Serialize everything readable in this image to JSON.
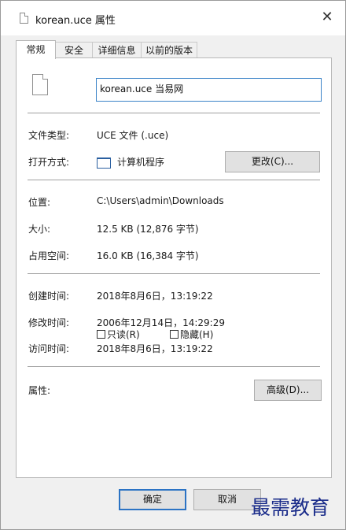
{
  "window": {
    "title": "korean.uce 属性",
    "close_glyph": "✕"
  },
  "tabs": [
    {
      "label": "常规"
    },
    {
      "label": "安全"
    },
    {
      "label": "详细信息"
    },
    {
      "label": "以前的版本"
    }
  ],
  "general": {
    "file_name": "korean.uce   当易网",
    "file_type_label": "文件类型:",
    "file_type_value": "UCE 文件 (.uce)",
    "open_with_label": "打开方式:",
    "open_with_value": "计算机程序",
    "change_button": "更改(C)...",
    "location_label": "位置:",
    "location_value": "C:\\Users\\admin\\Downloads",
    "size_label": "大小:",
    "size_value": "12.5 KB (12,876 字节)",
    "size_on_disk_label": "占用空间:",
    "size_on_disk_value": "16.0 KB (16,384 字节)",
    "created_label": "创建时间:",
    "created_value": "2018年8月6日，13:19:22",
    "modified_label": "修改时间:",
    "modified_value": "2006年12月14日，14:29:29",
    "accessed_label": "访问时间:",
    "accessed_value": "2018年8月6日，13:19:22",
    "attributes_label": "属性:",
    "readonly_label": "只读(R)",
    "hidden_label": "隐藏(H)",
    "advanced_button": "高级(D)..."
  },
  "footer": {
    "ok": "确定",
    "cancel": "取消"
  },
  "watermark": "最需教育"
}
